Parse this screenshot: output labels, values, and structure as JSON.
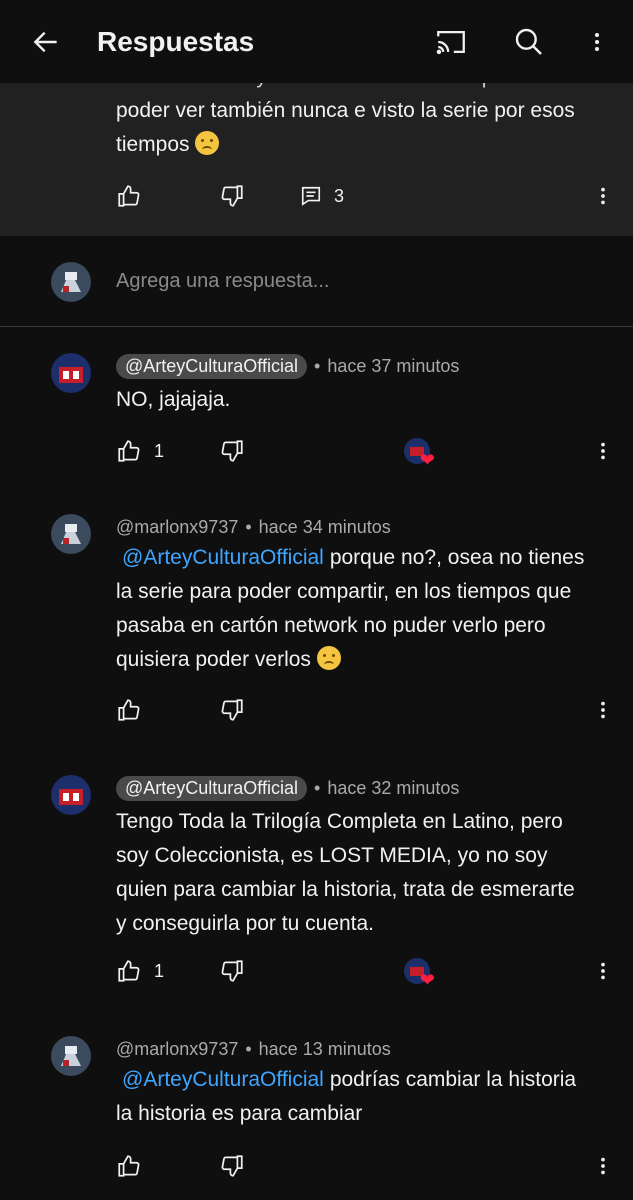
{
  "header": {
    "title": "Respuestas"
  },
  "parent_comment": {
    "text_truncated": "Transformers cybertron en audio latino para",
    "text_lines": "poder ver también nunca e visto la serie por esos tiempos",
    "reply_count": "3"
  },
  "reply_input": {
    "placeholder": "Agrega una respuesta..."
  },
  "replies": [
    {
      "handle": "@ArteyCulturaOfficial",
      "time": "hace 37 minutos",
      "mention": "",
      "text": "NO, jajajaja.",
      "likes": "1",
      "creator_heart": true
    },
    {
      "handle": "@marlonx9737",
      "time": "hace 34 minutos",
      "mention": "@ArteyCulturaOfficial",
      "text": "porque no?, osea no tienes la serie para poder compartir, en los tiempos que pasaba en cartón network no puder verlo pero quisiera poder verlos",
      "likes": "",
      "creator_heart": false
    },
    {
      "handle": "@ArteyCulturaOfficial",
      "time": "hace 32 minutos",
      "mention": "",
      "text": "Tengo Toda la Trilogía Completa en Latino, pero soy Coleccionista, es LOST MEDIA, yo no soy quien para cambiar la historia, trata de esmerarte y conseguirla por tu cuenta.",
      "likes": "1",
      "creator_heart": true
    },
    {
      "handle": "@marlonx9737",
      "time": "hace 13 minutos",
      "mention": "@ArteyCulturaOfficial",
      "text": "podrías cambiar la historia la historia es para cambiar",
      "likes": "",
      "creator_heart": false
    }
  ],
  "separator": "•",
  "colors": {
    "background": "#0f0f0f",
    "parent_bg": "#212121",
    "mention": "#3ea6ff",
    "heart": "#ff1f3d"
  }
}
